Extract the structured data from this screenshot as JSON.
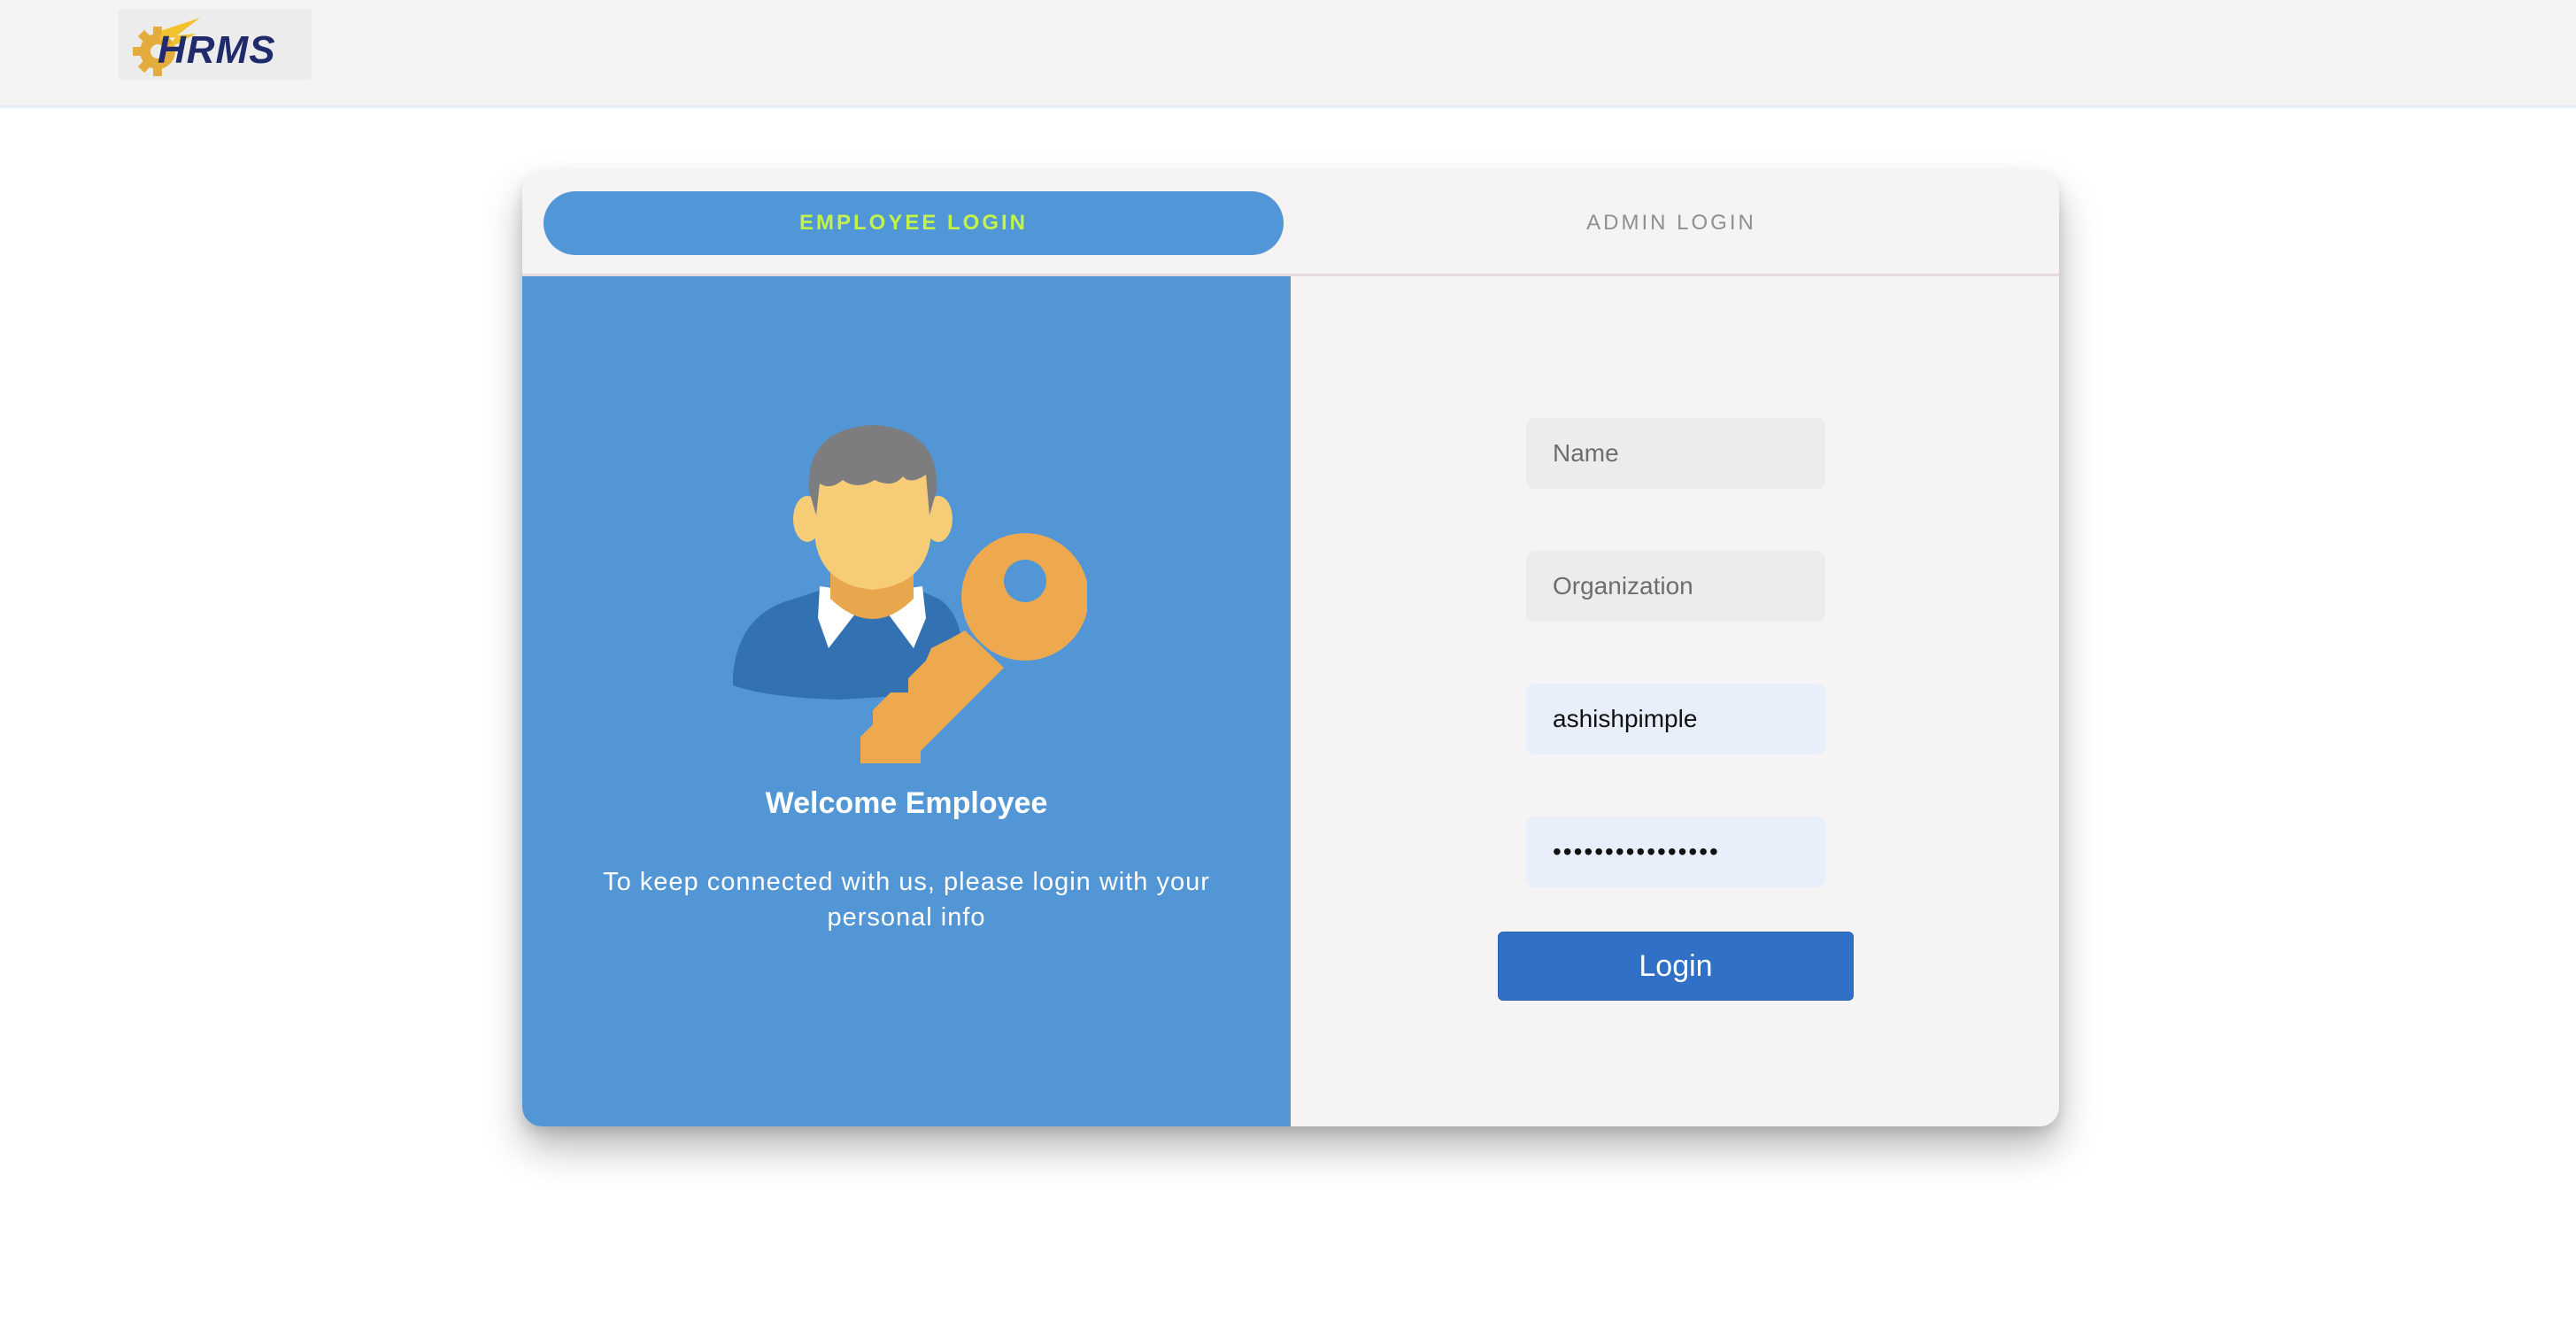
{
  "header": {
    "logo_text": "HRMS"
  },
  "tabs": {
    "employee_label": "EMPLOYEE LOGIN",
    "admin_label": "ADMIN LOGIN",
    "active": "employee"
  },
  "left_panel": {
    "illustration_icon": "employee-key-icon",
    "title": "Welcome Employee",
    "subtitle": "To keep connected with us, please login with your personal info"
  },
  "form": {
    "name_placeholder": "Name",
    "name_value": "",
    "organization_placeholder": "Organization",
    "organization_value": "",
    "username_value": "ashishpimple",
    "password_masked": "••••••••••••••••",
    "login_label": "Login"
  },
  "colors": {
    "primary_blue": "#5296d5",
    "button_blue": "#3071c7",
    "active_tab_text": "#c3f34a",
    "key_orange": "#eea94f",
    "autofill_bg": "#e8effb"
  }
}
